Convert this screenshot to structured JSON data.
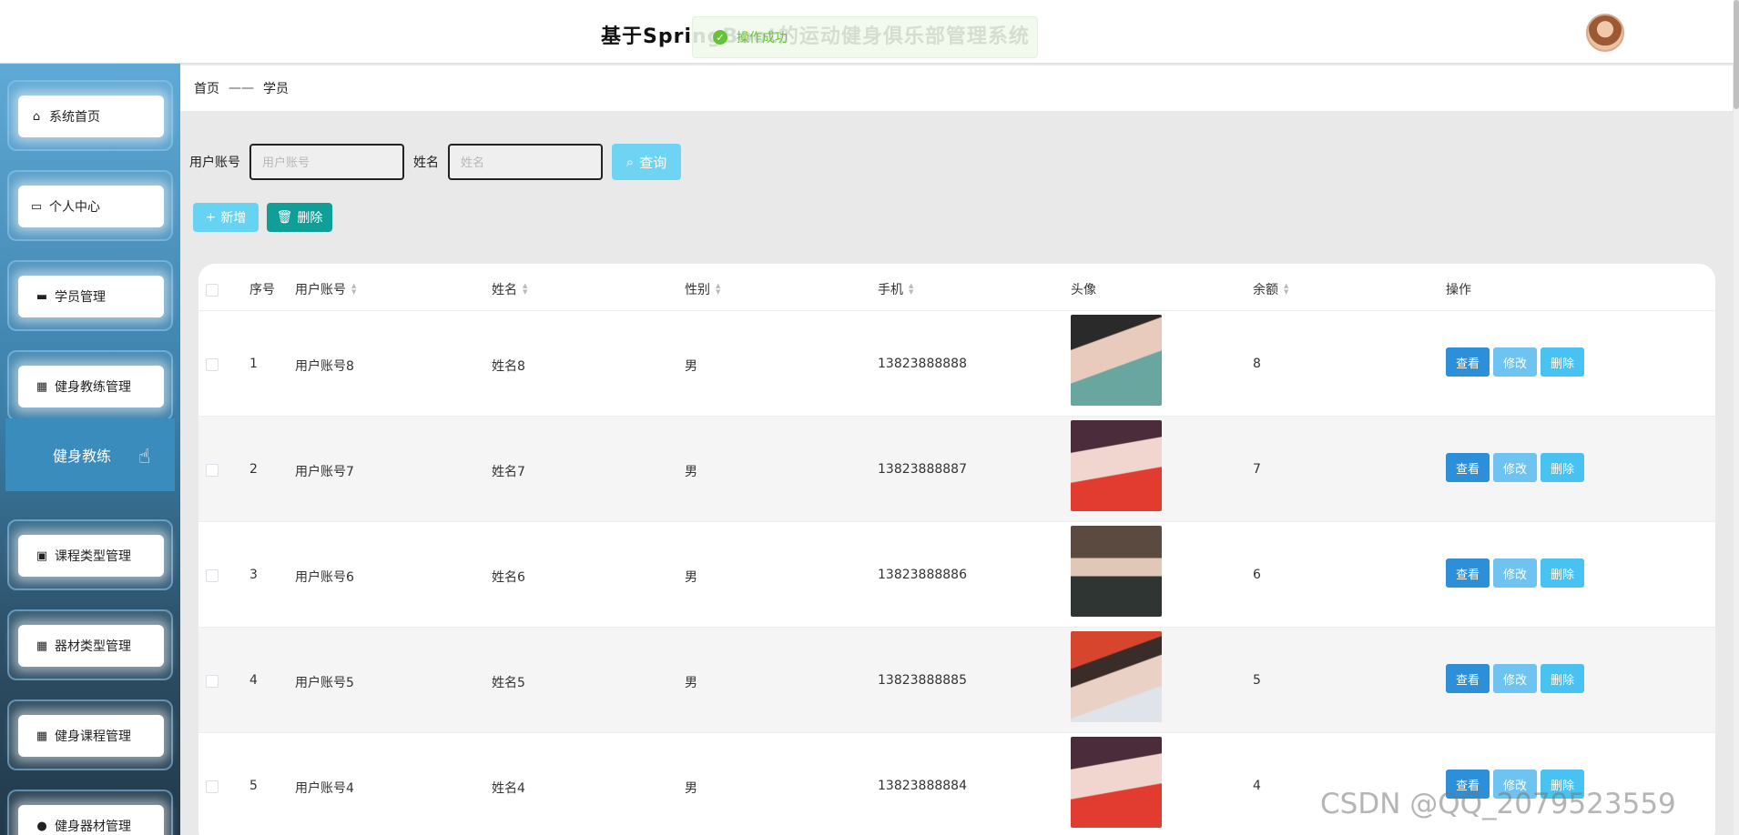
{
  "header": {
    "title": "基于SpringBoot的运动健身俱乐部管理系统",
    "toast": "操作成功"
  },
  "sidebar": {
    "items": [
      {
        "label": "系统首页",
        "icon": "home-icon"
      },
      {
        "label": "个人中心",
        "icon": "card-icon"
      },
      {
        "label": "学员管理",
        "icon": "briefcase-icon"
      },
      {
        "label": "健身教练管理",
        "icon": "grid-icon"
      },
      {
        "label": "课程类型管理",
        "icon": "clipboard-icon"
      },
      {
        "label": "器材类型管理",
        "icon": "grid-icon"
      },
      {
        "label": "健身课程管理",
        "icon": "grid-icon"
      },
      {
        "label": "健身器材管理",
        "icon": "bulb-icon"
      }
    ],
    "sub_item": "健身教练"
  },
  "breadcrumb": {
    "home": "首页",
    "sep": "——",
    "current": "学员"
  },
  "search": {
    "account_label": "用户账号",
    "account_placeholder": "用户账号",
    "name_label": "姓名",
    "name_placeholder": "姓名",
    "query_label": "查询"
  },
  "actions": {
    "add": "新增",
    "delete": "删除"
  },
  "table": {
    "columns": [
      "序号",
      "用户账号",
      "姓名",
      "性别",
      "手机",
      "头像",
      "余额",
      "操作"
    ],
    "rows": [
      {
        "index": "1",
        "account": "用户账号8",
        "name": "姓名8",
        "gender": "男",
        "phone": "13823888888",
        "balance": "8"
      },
      {
        "index": "2",
        "account": "用户账号7",
        "name": "姓名7",
        "gender": "男",
        "phone": "13823888887",
        "balance": "7"
      },
      {
        "index": "3",
        "account": "用户账号6",
        "name": "姓名6",
        "gender": "男",
        "phone": "13823888886",
        "balance": "6"
      },
      {
        "index": "4",
        "account": "用户账号5",
        "name": "姓名5",
        "gender": "男",
        "phone": "13823888885",
        "balance": "5"
      },
      {
        "index": "5",
        "account": "用户账号4",
        "name": "姓名4",
        "gender": "男",
        "phone": "13823888884",
        "balance": "4"
      }
    ],
    "row_actions": {
      "view": "查看",
      "edit": "修改",
      "delete": "删除"
    }
  },
  "watermark": "CSDN @QQ_2079523559"
}
